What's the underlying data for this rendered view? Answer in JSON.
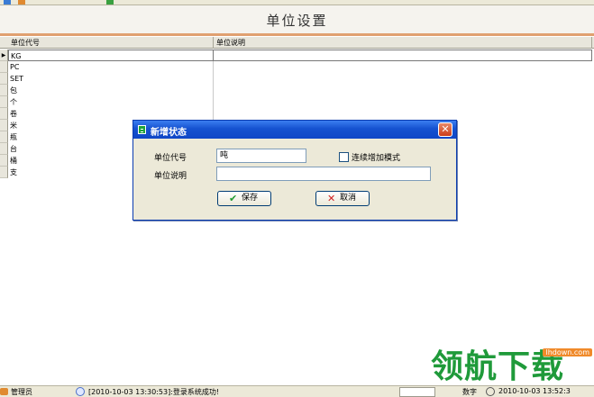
{
  "toolbar": {
    "items": [
      "",
      ""
    ]
  },
  "title": "单位设置",
  "grid": {
    "columns": [
      "单位代号",
      "单位说明"
    ],
    "selected_indicator": "▶",
    "rows": [
      "KG",
      "PC",
      "SET",
      "包",
      "个",
      "卷",
      "米",
      "瓶",
      "台",
      "桶",
      "支"
    ]
  },
  "dialog": {
    "title": "新增状态",
    "code_label": "单位代号",
    "code_value": "吨",
    "desc_label": "单位说明",
    "desc_value": "",
    "checkbox_label": "连续增加模式",
    "save_label": "保存",
    "cancel_label": "取消",
    "close_glyph": "✕"
  },
  "statusbar": {
    "user": "管理员",
    "message": "[2010-10-03 13:30:53]:登录系统成功!",
    "mode": "数字",
    "datetime": "2010-10-03 13:52:3"
  },
  "watermark": {
    "text": "领航下载",
    "url": "lhdown.com"
  }
}
